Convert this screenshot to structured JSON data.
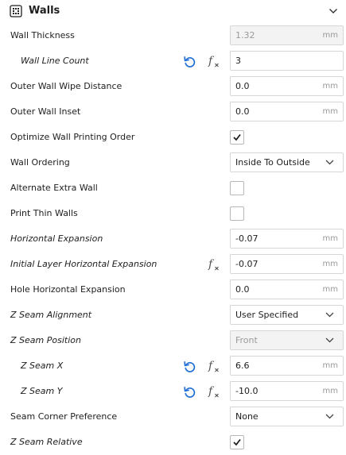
{
  "section": {
    "title": "Walls",
    "icon": "walls-grid-icon",
    "collapse_icon": "chevron-down-icon"
  },
  "icons": {
    "reset": "reset-arrow-icon",
    "function": "function-fx-icon",
    "accent": "#1e6fd6"
  },
  "settings": [
    {
      "id": "wall-thickness",
      "label": "Wall Thickness",
      "italic": false,
      "indent": false,
      "reset": false,
      "fx": false,
      "control": "number",
      "value": "1.32",
      "unit": "mm",
      "disabled": true
    },
    {
      "id": "wall-line-count",
      "label": "Wall Line Count",
      "italic": true,
      "indent": true,
      "reset": true,
      "fx": true,
      "control": "number",
      "value": "3",
      "unit": "",
      "disabled": false
    },
    {
      "id": "outer-wall-wipe-distance",
      "label": "Outer Wall Wipe Distance",
      "italic": false,
      "indent": false,
      "reset": false,
      "fx": false,
      "control": "number",
      "value": "0.0",
      "unit": "mm",
      "disabled": false
    },
    {
      "id": "outer-wall-inset",
      "label": "Outer Wall Inset",
      "italic": false,
      "indent": false,
      "reset": false,
      "fx": false,
      "control": "number",
      "value": "0.0",
      "unit": "mm",
      "disabled": false
    },
    {
      "id": "optimize-wall-printing-order",
      "label": "Optimize Wall Printing Order",
      "italic": false,
      "indent": false,
      "reset": false,
      "fx": false,
      "control": "checkbox",
      "checked": true
    },
    {
      "id": "wall-ordering",
      "label": "Wall Ordering",
      "italic": false,
      "indent": false,
      "reset": false,
      "fx": false,
      "control": "select",
      "value": "Inside To Outside",
      "disabled": false
    },
    {
      "id": "alternate-extra-wall",
      "label": "Alternate Extra Wall",
      "italic": false,
      "indent": false,
      "reset": false,
      "fx": false,
      "control": "checkbox",
      "checked": false
    },
    {
      "id": "print-thin-walls",
      "label": "Print Thin Walls",
      "italic": false,
      "indent": false,
      "reset": false,
      "fx": false,
      "control": "checkbox",
      "checked": false
    },
    {
      "id": "horizontal-expansion",
      "label": "Horizontal Expansion",
      "italic": true,
      "indent": false,
      "reset": false,
      "fx": false,
      "control": "number",
      "value": "-0.07",
      "unit": "mm",
      "disabled": false
    },
    {
      "id": "initial-layer-horizontal-expansion",
      "label": "Initial Layer Horizontal Expansion",
      "italic": true,
      "indent": false,
      "reset": false,
      "fx": true,
      "control": "number",
      "value": "-0.07",
      "unit": "mm",
      "disabled": false
    },
    {
      "id": "hole-horizontal-expansion",
      "label": "Hole Horizontal Expansion",
      "italic": false,
      "indent": false,
      "reset": false,
      "fx": false,
      "control": "number",
      "value": "0.0",
      "unit": "mm",
      "disabled": false
    },
    {
      "id": "z-seam-alignment",
      "label": "Z Seam Alignment",
      "italic": true,
      "indent": false,
      "reset": false,
      "fx": false,
      "control": "select",
      "value": "User Specified",
      "disabled": false
    },
    {
      "id": "z-seam-position",
      "label": "Z Seam Position",
      "italic": true,
      "indent": false,
      "reset": false,
      "fx": false,
      "control": "select",
      "value": "Front",
      "disabled": true
    },
    {
      "id": "z-seam-x",
      "label": "Z Seam X",
      "italic": true,
      "indent": true,
      "reset": true,
      "fx": true,
      "control": "number",
      "value": "6.6",
      "unit": "mm",
      "disabled": false
    },
    {
      "id": "z-seam-y",
      "label": "Z Seam Y",
      "italic": true,
      "indent": true,
      "reset": true,
      "fx": true,
      "control": "number",
      "value": "-10.0",
      "unit": "mm",
      "disabled": false
    },
    {
      "id": "seam-corner-preference",
      "label": "Seam Corner Preference",
      "italic": false,
      "indent": false,
      "reset": false,
      "fx": false,
      "control": "select",
      "value": "None",
      "disabled": false
    },
    {
      "id": "z-seam-relative",
      "label": "Z Seam Relative",
      "italic": true,
      "indent": false,
      "reset": false,
      "fx": false,
      "control": "checkbox",
      "checked": true
    }
  ]
}
